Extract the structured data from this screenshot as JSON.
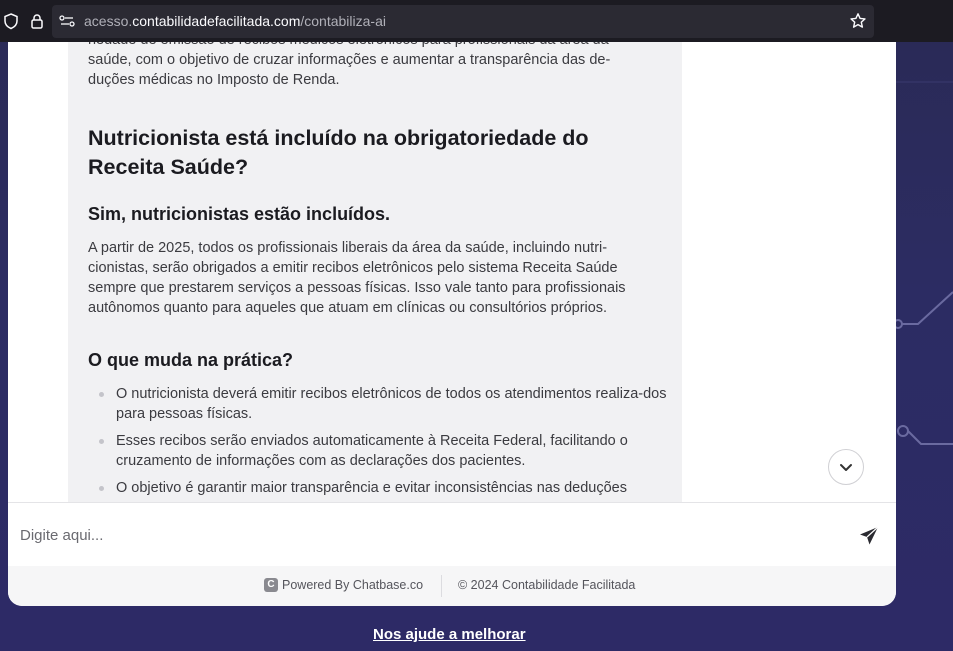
{
  "browser": {
    "url_prefix": "acesso.",
    "url_domain": "contabilidadefacilitada.com",
    "url_path": "/contabiliza-ai"
  },
  "message": {
    "intro": "riedade de emissão de recibos médicos eletrônicos para profissionais da área da saúde, com o objetivo de cruzar informações e aumentar a transparência das de-duções médicas no Imposto de Renda.",
    "heading": "Nutricionista está incluído na obrigatoriedade do Receita Saúde?",
    "subheading1": "Sim, nutricionistas estão incluídos.",
    "paragraph": "A partir de 2025, todos os profissionais liberais da área da saúde, incluindo nutri-cionistas, serão obrigados a emitir recibos eletrônicos pelo sistema Receita Saúde sempre que prestarem serviços a pessoas físicas. Isso vale tanto para profissionais autônomos quanto para aqueles que atuam em clínicas ou consultórios próprios.",
    "subheading2": "O que muda na prática?",
    "bullets": [
      "O nutricionista deverá emitir recibos eletrônicos de todos os atendimentos realiza-dos para pessoas físicas.",
      "Esses recibos serão enviados automaticamente à Receita Federal, facilitando o cruzamento de informações com as declarações dos pacientes.",
      "O objetivo é garantir maior transparência e evitar inconsistências nas deduções"
    ]
  },
  "input": {
    "placeholder": "Digite aqui..."
  },
  "footer": {
    "logo_letter": "C",
    "powered_by": "Powered By Chatbase.co",
    "copyright": "© 2024 Contabilidade Facilitada"
  },
  "help_link": "Nos ajude a melhorar",
  "colors": {
    "background": "#2c2c63",
    "bubble": "#f1f1f3",
    "text": "#3b3b40"
  }
}
